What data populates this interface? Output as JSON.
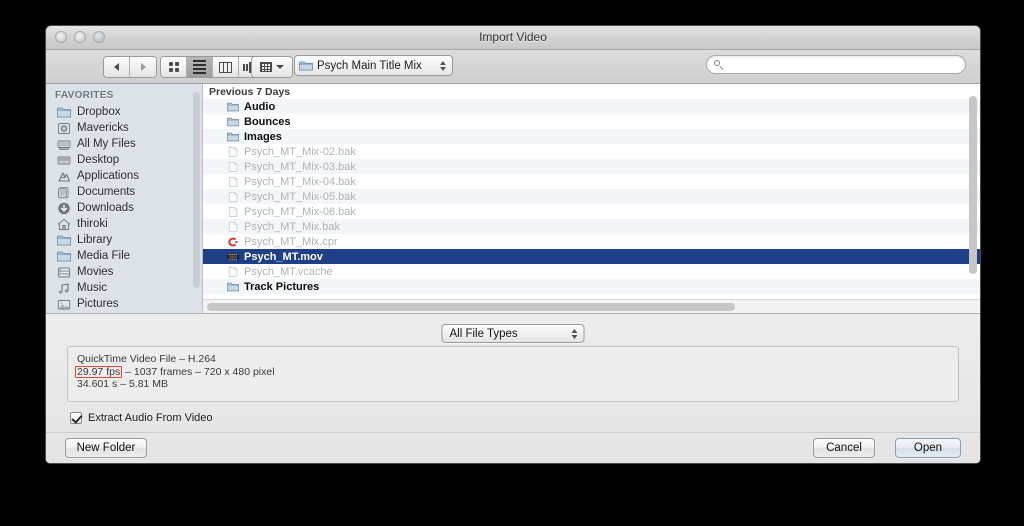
{
  "window": {
    "title": "Import Video",
    "traffic_lights": [
      "close-button",
      "minimize-button",
      "zoom-button"
    ]
  },
  "toolbar": {
    "back_label": "Back",
    "forward_label": "Forward",
    "view_modes": [
      {
        "name": "icon-view",
        "selected": false
      },
      {
        "name": "list-view",
        "selected": true
      },
      {
        "name": "column-view",
        "selected": false
      },
      {
        "name": "coverflow-view",
        "selected": false
      }
    ],
    "action_menu_label": "Action",
    "path_popup_label": "Psych Main Title Mix",
    "search_value": "",
    "search_placeholder": ""
  },
  "sidebar": {
    "header": "FAVORITES",
    "items": [
      {
        "label": "Dropbox",
        "icon": "folder-icon"
      },
      {
        "label": "Mavericks",
        "icon": "disk-icon"
      },
      {
        "label": "All My Files",
        "icon": "all-my-files-icon"
      },
      {
        "label": "Desktop",
        "icon": "desktop-icon"
      },
      {
        "label": "Applications",
        "icon": "applications-icon"
      },
      {
        "label": "Documents",
        "icon": "documents-icon"
      },
      {
        "label": "Downloads",
        "icon": "downloads-icon"
      },
      {
        "label": "thiroki",
        "icon": "home-icon"
      },
      {
        "label": "Library",
        "icon": "folder-icon"
      },
      {
        "label": "Media File",
        "icon": "folder-icon"
      },
      {
        "label": "Movies",
        "icon": "movies-icon"
      },
      {
        "label": "Music",
        "icon": "music-icon"
      },
      {
        "label": "Pictures",
        "icon": "pictures-icon"
      }
    ]
  },
  "filelist": {
    "group_header": "Previous 7 Days",
    "rows": [
      {
        "name": "Audio",
        "kind": "folder",
        "icon": "folder-icon",
        "selected": false,
        "dimmed": false
      },
      {
        "name": "Bounces",
        "kind": "folder",
        "icon": "folder-icon",
        "selected": false,
        "dimmed": false
      },
      {
        "name": "Images",
        "kind": "folder",
        "icon": "folder-icon",
        "selected": false,
        "dimmed": false
      },
      {
        "name": "Psych_MT_Mix-02.bak",
        "kind": "file",
        "icon": "document-icon",
        "selected": false,
        "dimmed": true
      },
      {
        "name": "Psych_MT_Mix-03.bak",
        "kind": "file",
        "icon": "document-icon",
        "selected": false,
        "dimmed": true
      },
      {
        "name": "Psych_MT_Mix-04.bak",
        "kind": "file",
        "icon": "document-icon",
        "selected": false,
        "dimmed": true
      },
      {
        "name": "Psych_MT_Mix-05.bak",
        "kind": "file",
        "icon": "document-icon",
        "selected": false,
        "dimmed": true
      },
      {
        "name": "Psych_MT_Mix-06.bak",
        "kind": "file",
        "icon": "document-icon",
        "selected": false,
        "dimmed": true
      },
      {
        "name": "Psych_MT_Mix.bak",
        "kind": "file",
        "icon": "document-icon",
        "selected": false,
        "dimmed": true
      },
      {
        "name": "Psych_MT_Mix.cpr",
        "kind": "file",
        "icon": "cubase-project-icon",
        "selected": false,
        "dimmed": true
      },
      {
        "name": "Psych_MT.mov",
        "kind": "file",
        "icon": "movie-file-icon",
        "selected": true,
        "dimmed": false
      },
      {
        "name": "Psych_MT.vcache",
        "kind": "file",
        "icon": "document-icon",
        "selected": false,
        "dimmed": true
      },
      {
        "name": "Track Pictures",
        "kind": "folder",
        "icon": "folder-icon",
        "selected": false,
        "dimmed": false
      }
    ]
  },
  "accessory": {
    "filetype_label": "All File Types",
    "info": {
      "line1": "QuickTime Video File – H.264",
      "fps": "29.97 fps",
      "line2_rest": " – 1037 frames – 720 x 480 pixel",
      "line3": "34.601 s – 5.81 MB",
      "highlight_color": "#ef4338"
    },
    "extract_audio_label": "Extract Audio From Video",
    "extract_audio_checked": true
  },
  "buttons": {
    "new_folder": "New Folder",
    "cancel": "Cancel",
    "open": "Open"
  },
  "colors": {
    "selection_blue": "#1f3f87",
    "sidebar_bg": "#dde2e9",
    "highlight_red": "#ef4338"
  }
}
